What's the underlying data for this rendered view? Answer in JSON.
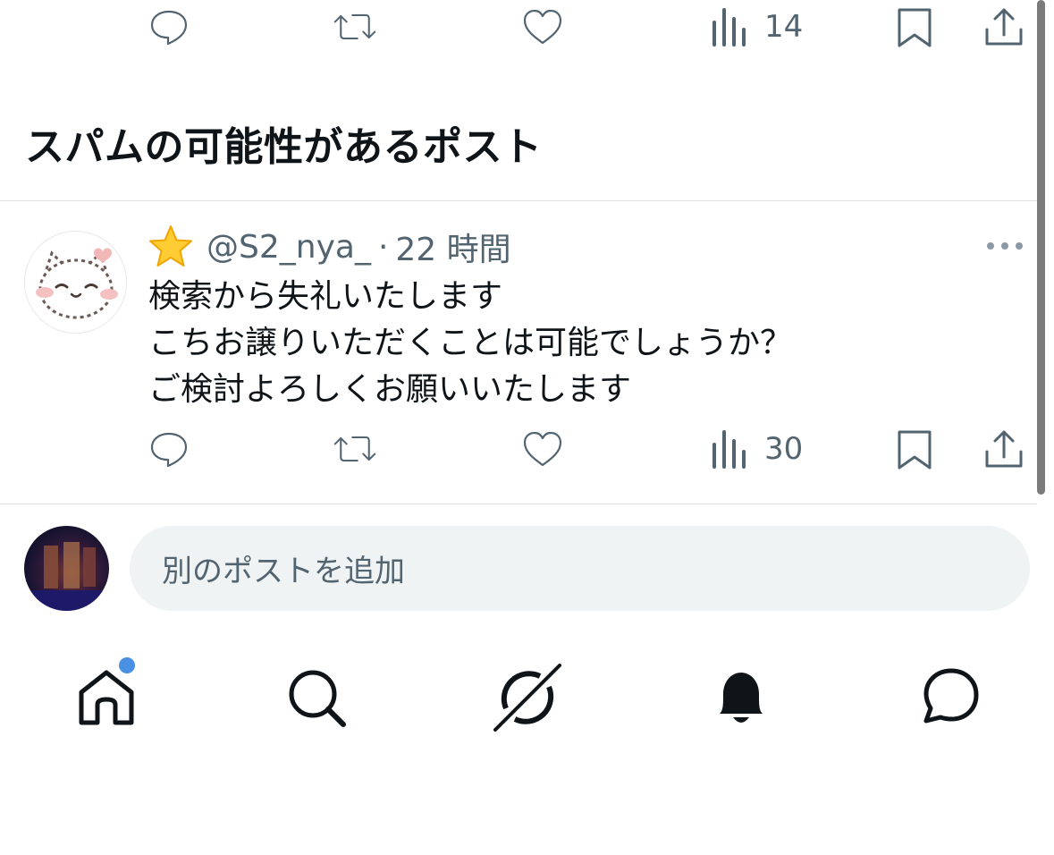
{
  "top_actions": {
    "views_count": "14"
  },
  "section_title": "スパムの可能性があるポスト",
  "post": {
    "handle": "@S2_nya_",
    "separator": "·",
    "time": "22 時間",
    "lines": [
      "検索から失礼いたします",
      "こちお譲りいただくことは可能でしょうか？",
      "ご検討よろしくお願いいたします"
    ],
    "views_count": "30"
  },
  "reply": {
    "placeholder": "別のポストを追加"
  },
  "icons": [
    "reply-icon",
    "repost-icon",
    "like-icon",
    "views-icon",
    "bookmark-icon",
    "share-icon",
    "more-icon",
    "star-emoji-icon",
    "home-icon",
    "search-icon",
    "grok-icon",
    "bell-icon",
    "messages-icon"
  ],
  "colors": {
    "text": "#0f1419",
    "secondary": "#536471",
    "input_bg": "#eff3f4",
    "notification_dot": "#4a90e2",
    "divider": "#dfe3e6"
  }
}
